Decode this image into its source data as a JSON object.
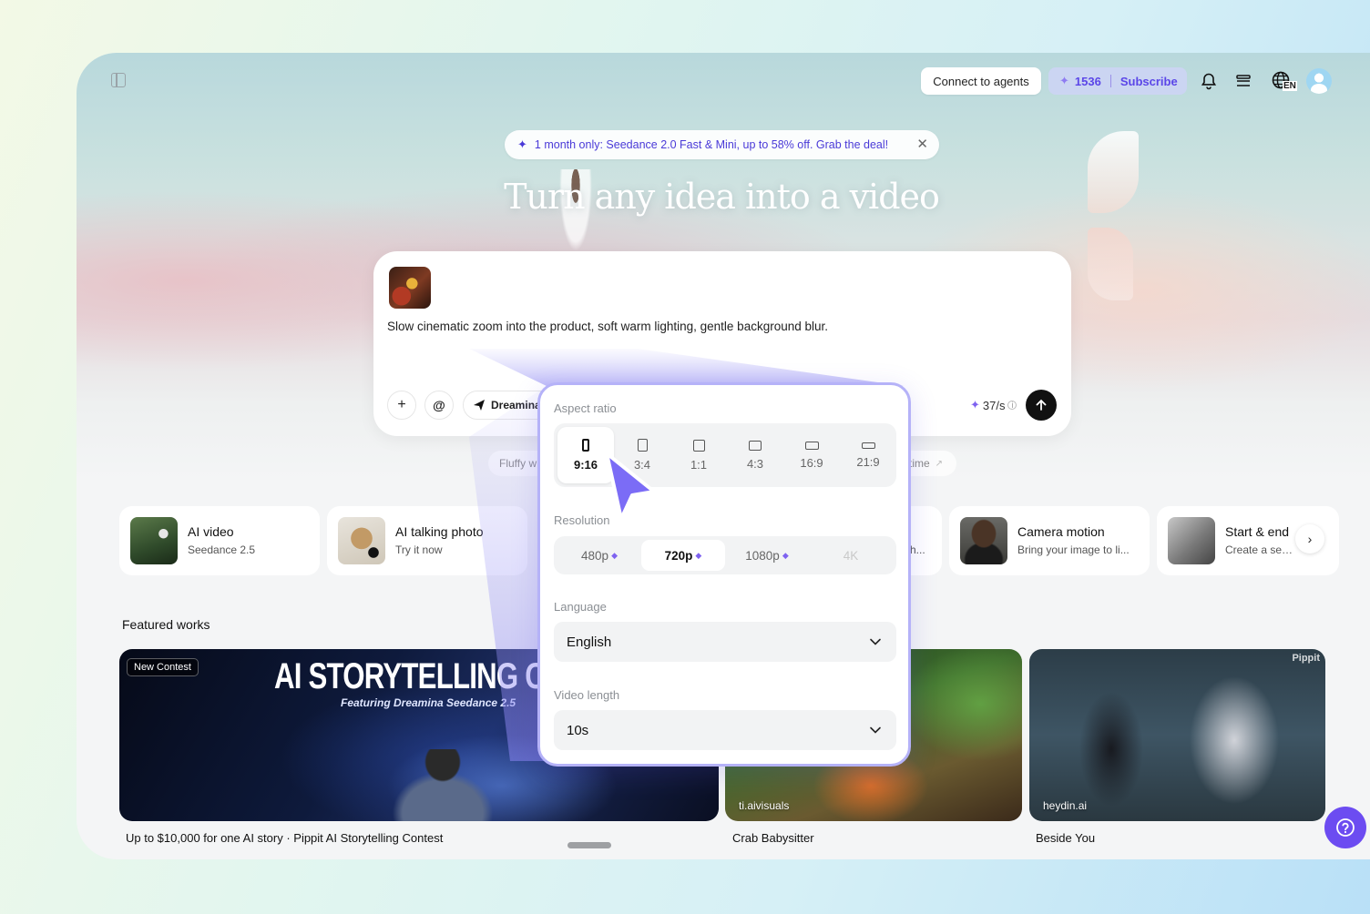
{
  "topbar": {
    "connect_label": "Connect to agents",
    "credits": "1536",
    "subscribe_label": "Subscribe",
    "lang_badge": "EN"
  },
  "promo": {
    "text": "1 month only: Seedance 2.0 Fast & Mini, up to 58% off. Grab the deal!",
    "close": "✕"
  },
  "hero": {
    "title": "Turn any idea into a video"
  },
  "composer": {
    "prompt": "Slow cinematic zoom into the product, soft warm lighting, gentle background blur.",
    "add": "+",
    "mention": "@",
    "model_label": "Dreamina",
    "cost": "37/s"
  },
  "suggestions": [
    "Fluffy w",
    "time"
  ],
  "features": [
    {
      "title": "AI video",
      "subtitle": "Seedance 2.5"
    },
    {
      "title": "AI talking photo",
      "subtitle": "Try it now"
    },
    {
      "title": "Camera motion",
      "subtitle": "Bring your image to li..."
    },
    {
      "title": "Start & end",
      "subtitle": "Create a seam..."
    }
  ],
  "features_partial_text": "h...",
  "featured": {
    "label": "Featured works",
    "works": [
      {
        "badge": "New Contest",
        "headline": "AI STORYTELLING CONTE",
        "subheadline": "Featuring Dreamina Seedance 2.5",
        "caption": "Up to $10,000 for one AI story · Pippit AI Storytelling Contest"
      },
      {
        "credit": "ti.aivisuals",
        "caption": "Crab Babysitter"
      },
      {
        "credit": "heydin.ai",
        "brand": "Pippit",
        "caption": "Beside You"
      }
    ]
  },
  "popup": {
    "aspect_label": "Aspect ratio",
    "ratios": [
      "9:16",
      "3:4",
      "1:1",
      "4:3",
      "16:9",
      "21:9"
    ],
    "selected_ratio": "9:16",
    "resolution_label": "Resolution",
    "resolutions": [
      "480p",
      "720p",
      "1080p",
      "4K"
    ],
    "selected_resolution": "720p",
    "language_label": "Language",
    "language_value": "English",
    "length_label": "Video length",
    "length_value": "10s"
  },
  "colors": {
    "accent": "#6c4cf1",
    "accent_text": "#5b46e8",
    "popup_border": "#b5b2f8"
  }
}
